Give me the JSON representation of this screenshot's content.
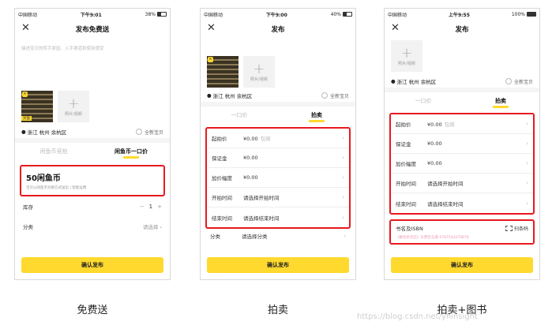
{
  "screens": [
    {
      "status": {
        "carrier": "中国移动",
        "time": "下午9:01",
        "battery": "38%",
        "battery_level": 0.38
      },
      "title": "发布免费送",
      "description_placeholder": "描述宝贝的转手原因、入手渠道和使用感受",
      "thumb_cover_label": "封面",
      "add_media_label": "照片/视频",
      "location": "浙江 杭州 余杭区",
      "new_item_label": "全新宝贝",
      "tabs": [
        "闲鱼币竞拍",
        "闲鱼币一口价"
      ],
      "coin_value": "50闲鱼币",
      "coin_hint": "宝贝以闲鱼币兑换方式送出 | 智能运费",
      "stock_label": "库存",
      "stock_minus": "−",
      "stock_value": "1",
      "stock_plus": "+",
      "category_label": "分类",
      "category_placeholder": "请选择",
      "confirm": "确认发布"
    },
    {
      "status": {
        "carrier": "中国移动",
        "time": "下午9:00",
        "battery": "40%",
        "battery_level": 0.4
      },
      "title": "发布",
      "add_media_label": "照片/视频",
      "location": "浙江 杭州 余杭区",
      "new_item_label": "全新宝贝",
      "tabs": [
        "一口价",
        "拍卖"
      ],
      "fields": [
        {
          "label": "起拍价",
          "value": "¥0.00",
          "hint": "包邮"
        },
        {
          "label": "保证金",
          "value": "¥0.00",
          "hint": ""
        },
        {
          "label": "加价幅度",
          "value": "¥0.00",
          "hint": ""
        },
        {
          "label": "开拍时间",
          "value": "请选择开拍时间",
          "hint": ""
        },
        {
          "label": "结束时间",
          "value": "请选择结束时间",
          "hint": ""
        }
      ],
      "category_label": "分类",
      "category_placeholder": "请选择分类",
      "confirm": "确认发布"
    },
    {
      "status": {
        "carrier": "中国移动",
        "time": "上午9:55",
        "battery": "100%",
        "battery_level": 1.0
      },
      "title": "发布",
      "add_media_label": "照片/视频",
      "location": "浙江 杭州 余杭区",
      "new_item_label": "全新宝贝",
      "tabs": [
        "一口价",
        "拍卖"
      ],
      "fields": [
        {
          "label": "起拍价",
          "value": "¥0.00",
          "hint": "包邮"
        },
        {
          "label": "保证金",
          "value": "¥0.00",
          "hint": ""
        },
        {
          "label": "加价幅度",
          "value": "¥0.00",
          "hint": ""
        },
        {
          "label": "开拍时间",
          "value": "请选择开拍时间",
          "hint": ""
        },
        {
          "label": "结束时间",
          "value": "请选择结束时间",
          "hint": ""
        }
      ],
      "isbn_label": "书名及ISBN",
      "scan_label": "扫条码",
      "isbn_hint": "《解忧杂货店》东野圭吾著 9787544270878",
      "confirm": "确认发布"
    }
  ],
  "captions": [
    "免费送",
    "拍卖",
    "拍卖+图书"
  ],
  "watermark": "https://blog.csdn.net/yhinsight",
  "colors": {
    "accent": "#ffd92e",
    "highlight_box": "#e8191e"
  }
}
